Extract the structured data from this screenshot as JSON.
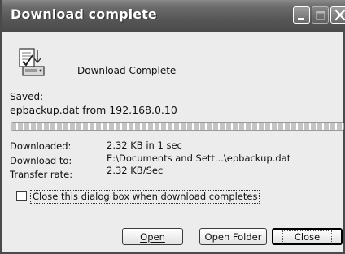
{
  "window": {
    "title": "Download complete",
    "controls": [
      "minimize-icon",
      "maximize-icon",
      "close-icon"
    ]
  },
  "header": {
    "icon": "download-complete-icon",
    "text": "Download Complete"
  },
  "saved": {
    "label": "Saved:",
    "file": "epbackup.dat from 192.168.0.10"
  },
  "progress": {
    "fraction": 1.0
  },
  "details": {
    "downloaded_label": "Downloaded:",
    "downloaded_value": "2.32 KB in 1 sec",
    "download_to_label": "Download to:",
    "download_to_value": "E:\\Documents and Sett...\\epbackup.dat",
    "transfer_rate_label": "Transfer rate:",
    "transfer_rate_value": "2.32 KB/Sec"
  },
  "option": {
    "close_when_complete": "Close this dialog box when download completes",
    "checked": false
  },
  "buttons": {
    "open": "Open",
    "open_folder": "Open Folder",
    "close": "Close"
  }
}
